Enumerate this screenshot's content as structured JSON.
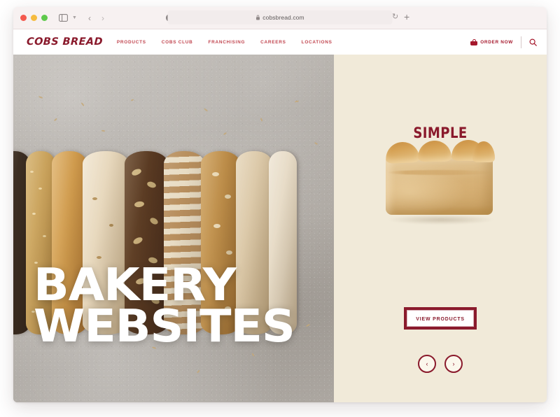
{
  "browser": {
    "url": "cobsbread.com",
    "lock_icon": "lock-icon",
    "reload_icon": "reload-icon",
    "new_tab_icon": "plus-icon",
    "sidebar_icon": "sidebar-toggle-icon",
    "back_icon": "‹",
    "forward_icon": "›",
    "traffic_lights": [
      "close",
      "minimize",
      "maximize"
    ]
  },
  "site": {
    "logo": "COBS BREAD",
    "nav": [
      {
        "label": "PRODUCTS"
      },
      {
        "label": "COBS CLUB"
      },
      {
        "label": "FRANCHISING"
      },
      {
        "label": "CAREERS"
      },
      {
        "label": "LOCATIONS"
      }
    ],
    "order_now": "ORDER NOW",
    "search_icon": "search-icon",
    "basket_icon": "basket-icon"
  },
  "hero": {
    "headline": "BAKERY\nWEBSITES",
    "photo_alt": "row-of-artisan-bread-loaves-on-concrete"
  },
  "panel": {
    "slide_title": "SIMPLE",
    "product_alt": "white-sandwich-loaf",
    "cta_label": "VIEW PRODUCTS",
    "prev_icon": "‹",
    "next_icon": "›"
  },
  "colors": {
    "brand_dark_red": "#8a1a2c",
    "nav_red": "#c1454f",
    "panel_cream": "#f1ead9",
    "header_white": "#ffffff"
  }
}
